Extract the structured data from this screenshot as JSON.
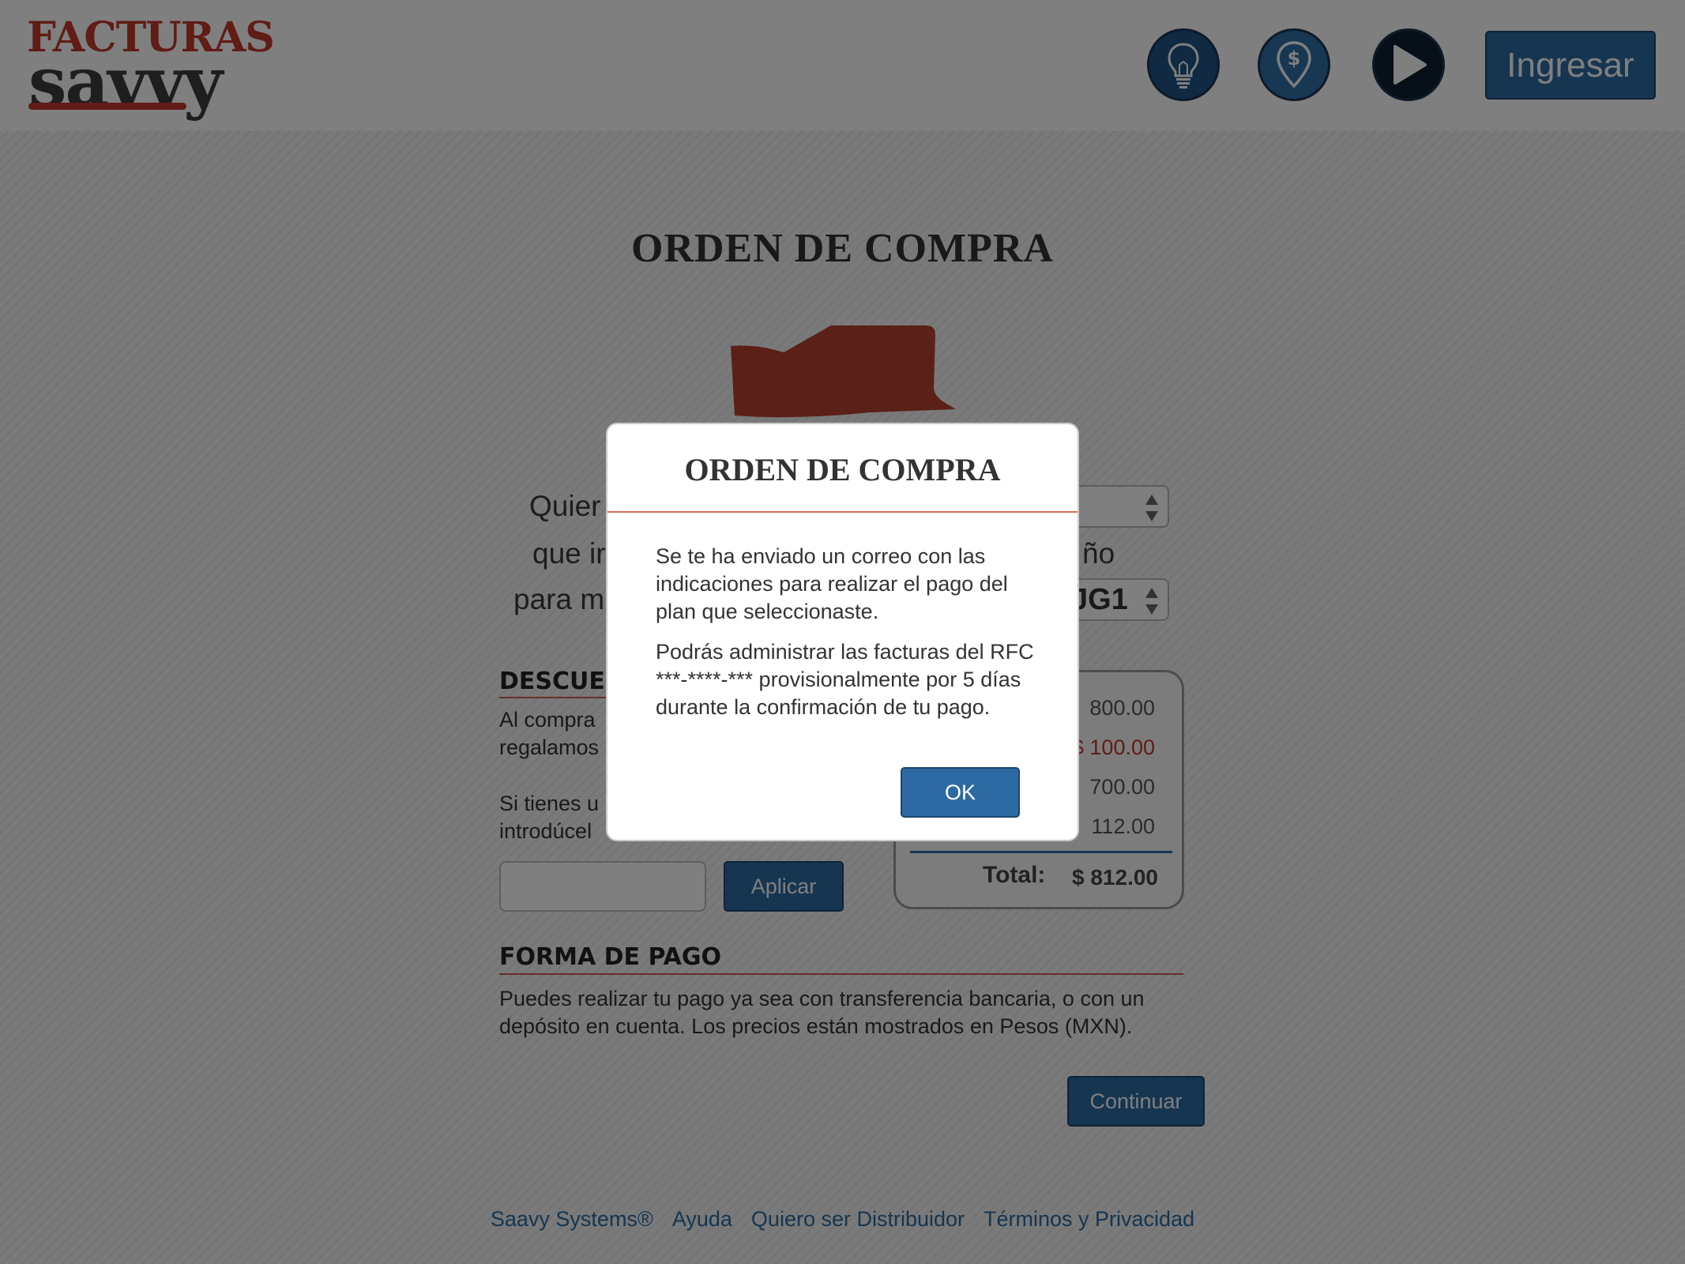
{
  "header": {
    "logo_top": "FACTURAS",
    "logo_bottom": "savvy",
    "icons": [
      "lightbulb-icon",
      "dollar-pin-icon",
      "play-icon"
    ],
    "login_label": "Ingresar"
  },
  "main": {
    "title": "ORDEN DE COMPRA",
    "lines": [
      "Quier",
      "que ir",
      "para m"
    ],
    "line_suffix_2": "ño",
    "select_1_value": ".",
    "select_2_value": "JG1",
    "discount": {
      "heading": "DESCUEN",
      "text_1": "Al compra\nregalamos",
      "text_2": "Si tienes u\nintrodúcel",
      "apply_label": "Aplicar"
    },
    "summary": {
      "rows": [
        "800.00",
        "$ 100.00",
        "700.00",
        "112.00"
      ],
      "total_label": "Total:",
      "total_value": "$ 812.00"
    },
    "payment": {
      "heading": "FORMA DE PAGO",
      "text": "Puedes realizar tu pago ya sea con transferencia bancaria, o con un depósito en cuenta. Los precios están mostrados en Pesos (MXN)."
    },
    "continue_label": "Continuar"
  },
  "footer": {
    "links": [
      "Saavy Systems®",
      "Ayuda",
      "Quiero ser Distribuidor",
      "Términos y Privacidad"
    ]
  },
  "modal": {
    "title": "ORDEN DE COMPRA",
    "paragraph_1": "Se te ha enviado un correo con las indicaciones para realizar el pago del plan que seleccionaste.",
    "paragraph_2": "Podrás administrar las facturas del RFC ***-****-*** provisionalmente por 5 días durante la confirmación de tu pago.",
    "ok_label": "OK"
  },
  "colors": {
    "brand_red": "#c0392b",
    "primary_blue": "#2d6aa3"
  }
}
